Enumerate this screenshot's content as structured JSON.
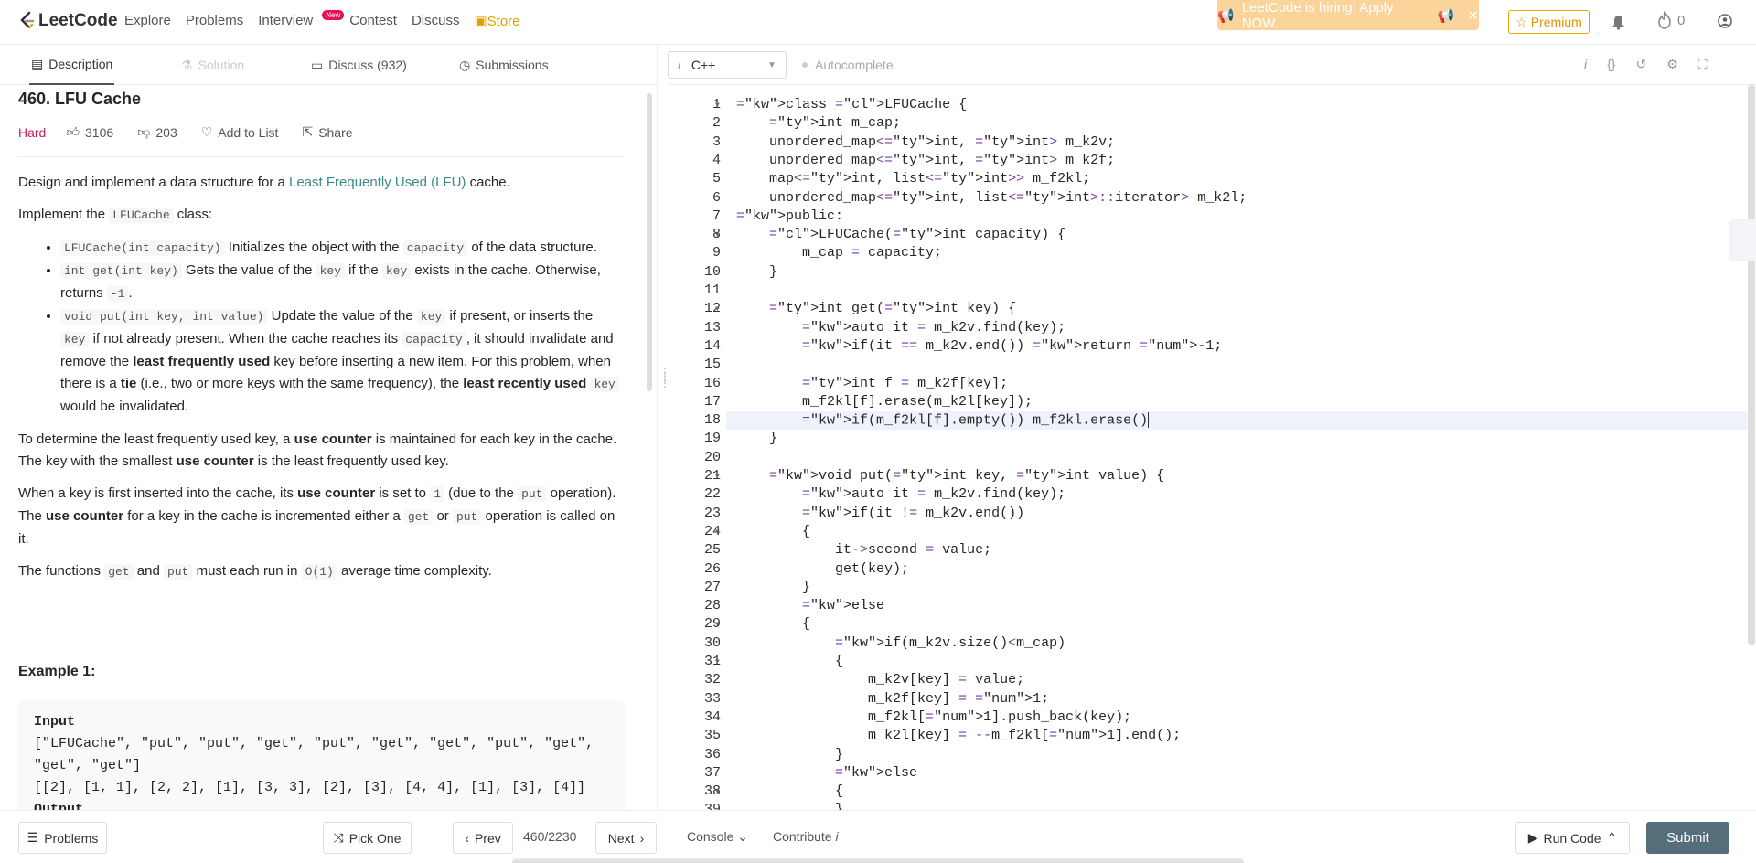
{
  "nav": {
    "brand": "LeetCode",
    "links": [
      "Explore",
      "Problems",
      "Interview",
      "Contest",
      "Discuss",
      "Store"
    ],
    "new_badge": "New",
    "hiring": "LeetCode is hiring! Apply NOW.",
    "premium": "Premium",
    "fire_count": "0"
  },
  "tabs": {
    "description": "Description",
    "solution": "Solution",
    "discuss": "Discuss (932)",
    "submissions": "Submissions"
  },
  "problem": {
    "title": "460. LFU Cache",
    "difficulty": "Hard",
    "likes": "3106",
    "dislikes": "203",
    "add_to_list": "Add to List",
    "share": "Share",
    "example_title": "Example 1:",
    "example_input_label": "Input",
    "example_line1": "[\"LFUCache\", \"put\", \"put\", \"get\", \"put\", \"get\", \"get\", \"put\", \"get\",",
    "example_line2": "\"get\", \"get\"]",
    "example_line3": "[[2], [1, 1], [2, 2], [1], [3, 3], [2], [3], [4, 4], [1], [3], [4]]",
    "example_output_label": "Output"
  },
  "editor": {
    "language": "C++",
    "lang_icon": "i",
    "autocomplete": "Autocomplete"
  },
  "code_lines": [
    "class LFUCache {",
    "    int m_cap;",
    "    unordered_map<int, int> m_k2v;",
    "    unordered_map<int, int> m_k2f;",
    "    map<int, list<int>> m_f2kl;",
    "    unordered_map<int, list<int>::iterator> m_k2l;",
    "public:",
    "    LFUCache(int capacity) {",
    "        m_cap = capacity;",
    "    }",
    "",
    "    int get(int key) {",
    "        auto it = m_k2v.find(key);",
    "        if(it == m_k2v.end()) return -1;",
    "",
    "        int f = m_k2f[key];",
    "        m_f2kl[f].erase(m_k2l[key]);",
    "        if(m_f2kl[f].empty()) m_f2kl.erase()",
    "    }",
    "",
    "    void put(int key, int value) {",
    "        auto it = m_k2v.find(key);",
    "        if(it != m_k2v.end())",
    "        {",
    "            it->second = value;",
    "            get(key);",
    "        }",
    "        else",
    "        {",
    "            if(m_k2v.size()<m_cap)",
    "            {",
    "                m_k2v[key] = value;",
    "                m_k2f[key] = 1;",
    "                m_f2kl[1].push_back(key);",
    "                m_k2l[key] = --m_f2kl[1].end();",
    "            }",
    "            else",
    "            {",
    "            }"
  ],
  "bottom": {
    "problems": "Problems",
    "pick_one": "Pick One",
    "prev": "Prev",
    "counter": "460/2230",
    "next": "Next",
    "console": "Console",
    "contribute": "Contribute",
    "contribute_icon": "i",
    "run_code": "Run Code",
    "submit": "Submit"
  }
}
